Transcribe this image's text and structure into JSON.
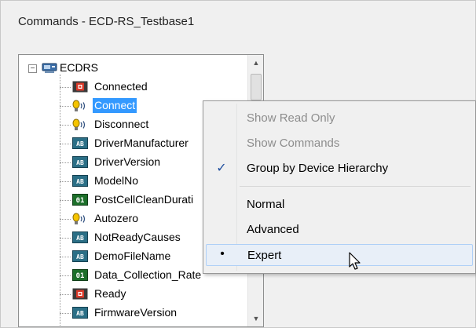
{
  "window": {
    "title": "Commands - ECD-RS_Testbase1"
  },
  "tree": {
    "root": {
      "toggle": "−",
      "label": "ECDRS",
      "icon": "device-icon"
    },
    "items": [
      {
        "label": "Connected",
        "icon": "error-status-icon",
        "selected": false
      },
      {
        "label": "Connect",
        "icon": "command-bulb-icon",
        "selected": true
      },
      {
        "label": "Disconnect",
        "icon": "command-bulb-icon",
        "selected": false
      },
      {
        "label": "DriverManufacturer",
        "icon": "text-value-icon",
        "selected": false
      },
      {
        "label": "DriverVersion",
        "icon": "text-value-icon",
        "selected": false
      },
      {
        "label": "ModelNo",
        "icon": "text-value-icon",
        "selected": false
      },
      {
        "label": "PostCellCleanDurati",
        "icon": "numeric-value-icon",
        "selected": false
      },
      {
        "label": "Autozero",
        "icon": "command-bulb-icon",
        "selected": false
      },
      {
        "label": "NotReadyCauses",
        "icon": "text-value-icon",
        "selected": false
      },
      {
        "label": "DemoFileName",
        "icon": "text-value-icon",
        "selected": false
      },
      {
        "label": "Data_Collection_Rate",
        "icon": "numeric-value-icon",
        "selected": false
      },
      {
        "label": "Ready",
        "icon": "error-status-icon",
        "selected": false
      },
      {
        "label": "FirmwareVersion",
        "icon": "text-value-icon",
        "selected": false
      }
    ]
  },
  "scrollbar": {
    "up_arrow": "▲",
    "down_arrow": "▼"
  },
  "context_menu": {
    "items": [
      {
        "label": "Show Read Only",
        "enabled": false,
        "mark": ""
      },
      {
        "label": "Show Commands",
        "enabled": false,
        "mark": ""
      },
      {
        "label": "Group by Device Hierarchy",
        "enabled": true,
        "mark": "✓"
      },
      {
        "label": "Normal",
        "enabled": true,
        "mark": ""
      },
      {
        "label": "Advanced",
        "enabled": true,
        "mark": ""
      },
      {
        "label": "Expert",
        "enabled": true,
        "mark": "•",
        "highlighted": true
      }
    ]
  },
  "colors": {
    "selection": "#3399ff",
    "menu_highlight": "#e8eff8",
    "check_mark": "#1f4e9e",
    "disabled_text": "#8d8d8d"
  }
}
